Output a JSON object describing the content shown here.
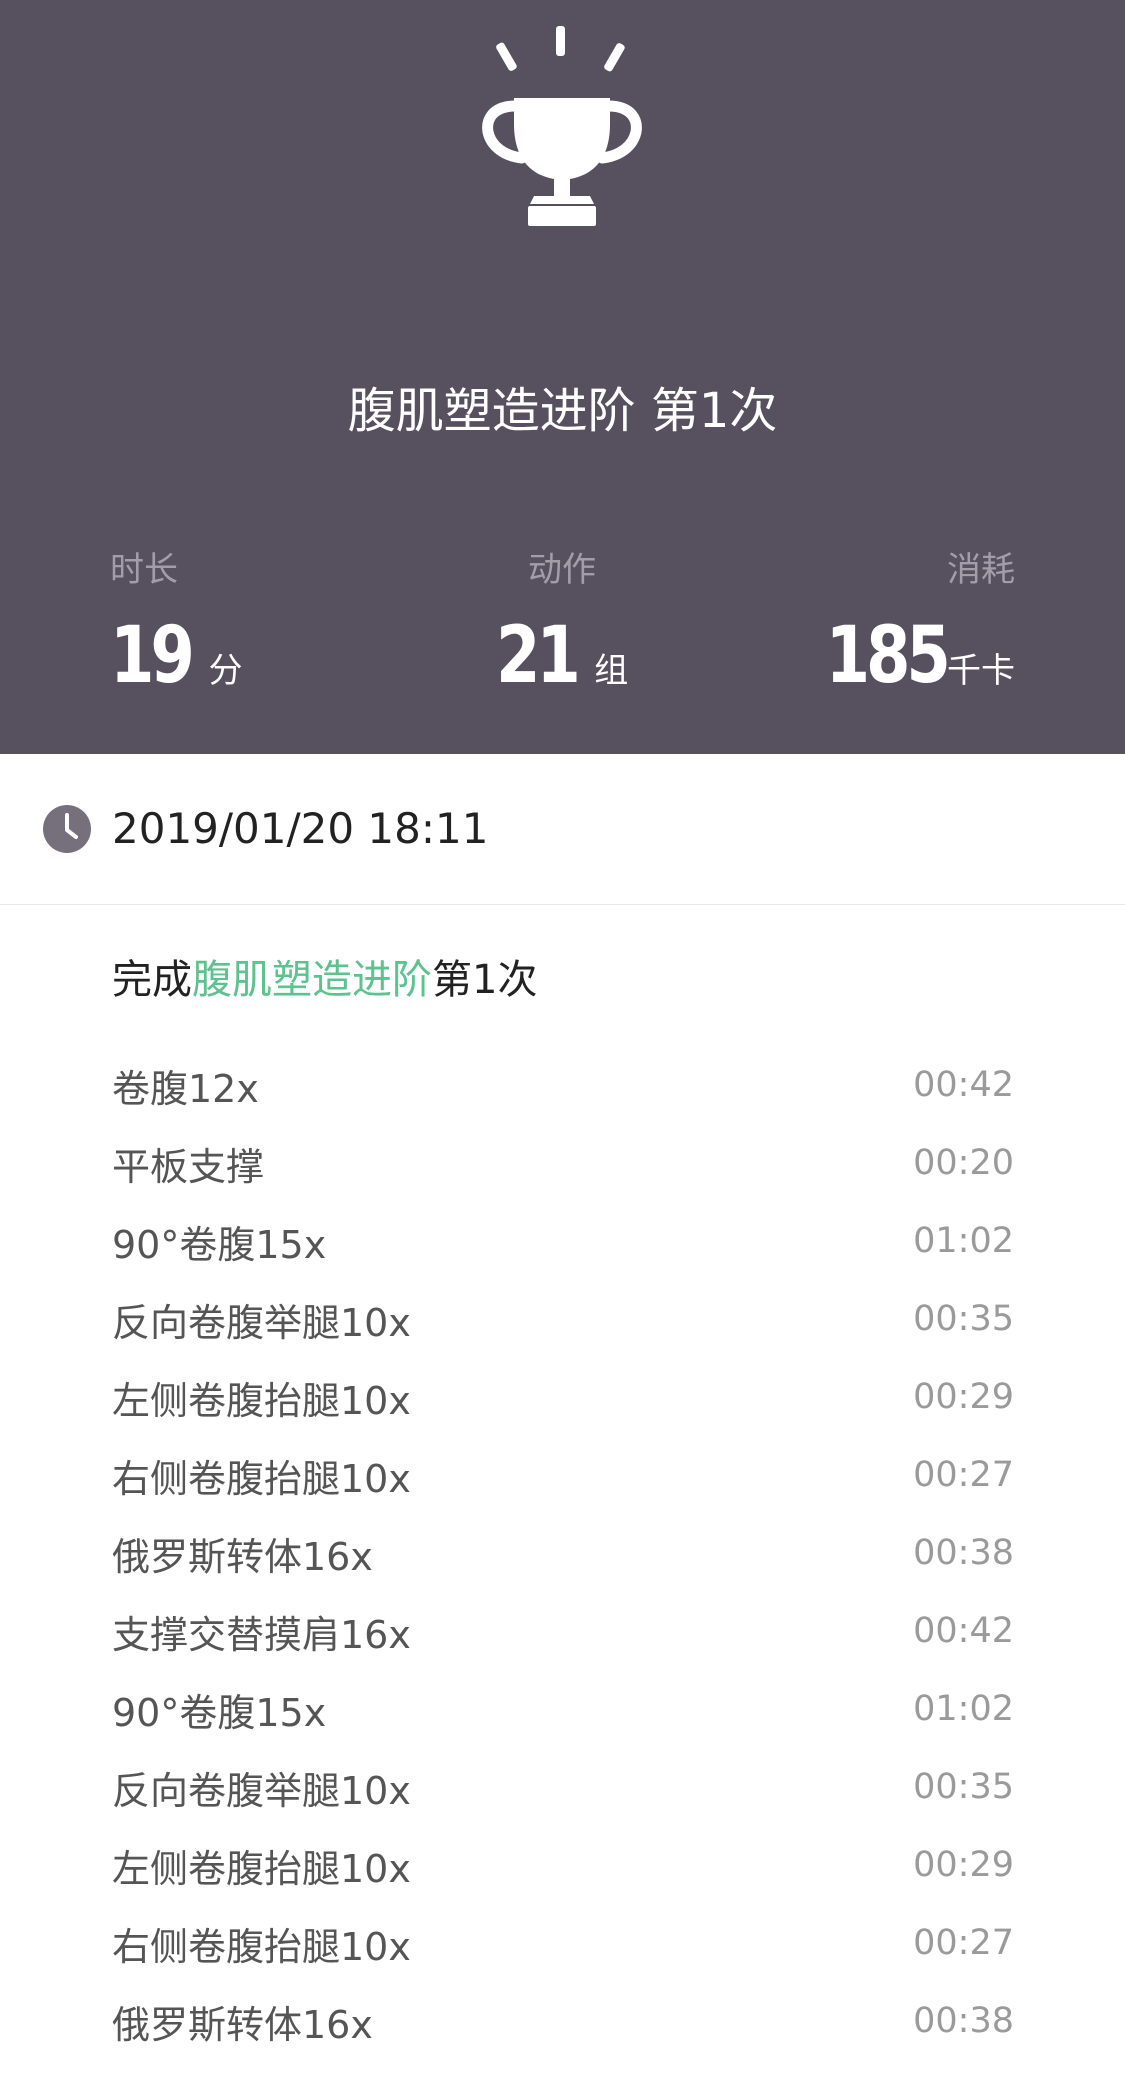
{
  "header": {
    "title": "腹肌塑造进阶 第1次",
    "stats": [
      {
        "label": "时长",
        "value": "19",
        "unit": "分"
      },
      {
        "label": "动作",
        "value": "21",
        "unit": "组"
      },
      {
        "label": "消耗",
        "value": "185",
        "unit": "千卡"
      }
    ]
  },
  "record": {
    "datetime": "2019/01/20 18:11"
  },
  "summary": {
    "prefix": "完成",
    "course": "腹肌塑造进阶",
    "suffix": "第1次"
  },
  "exercises": [
    {
      "name": "卷腹12x",
      "time": "00:42"
    },
    {
      "name": "平板支撑",
      "time": "00:20"
    },
    {
      "name": "90°卷腹15x",
      "time": "01:02"
    },
    {
      "name": "反向卷腹举腿10x",
      "time": "00:35"
    },
    {
      "name": "左侧卷腹抬腿10x",
      "time": "00:29"
    },
    {
      "name": "右侧卷腹抬腿10x",
      "time": "00:27"
    },
    {
      "name": "俄罗斯转体16x",
      "time": "00:38"
    },
    {
      "name": "支撑交替摸肩16x",
      "time": "00:42"
    },
    {
      "name": "90°卷腹15x",
      "time": "01:02"
    },
    {
      "name": "反向卷腹举腿10x",
      "time": "00:35"
    },
    {
      "name": "左侧卷腹抬腿10x",
      "time": "00:29"
    },
    {
      "name": "右侧卷腹抬腿10x",
      "time": "00:27"
    },
    {
      "name": "俄罗斯转体16x",
      "time": "00:38"
    }
  ],
  "colors": {
    "header_bg": "#57505f",
    "accent": "#5cc28e",
    "icon": "#76707c"
  },
  "icons": {
    "trophy": "trophy-icon",
    "clock": "clock-icon"
  }
}
